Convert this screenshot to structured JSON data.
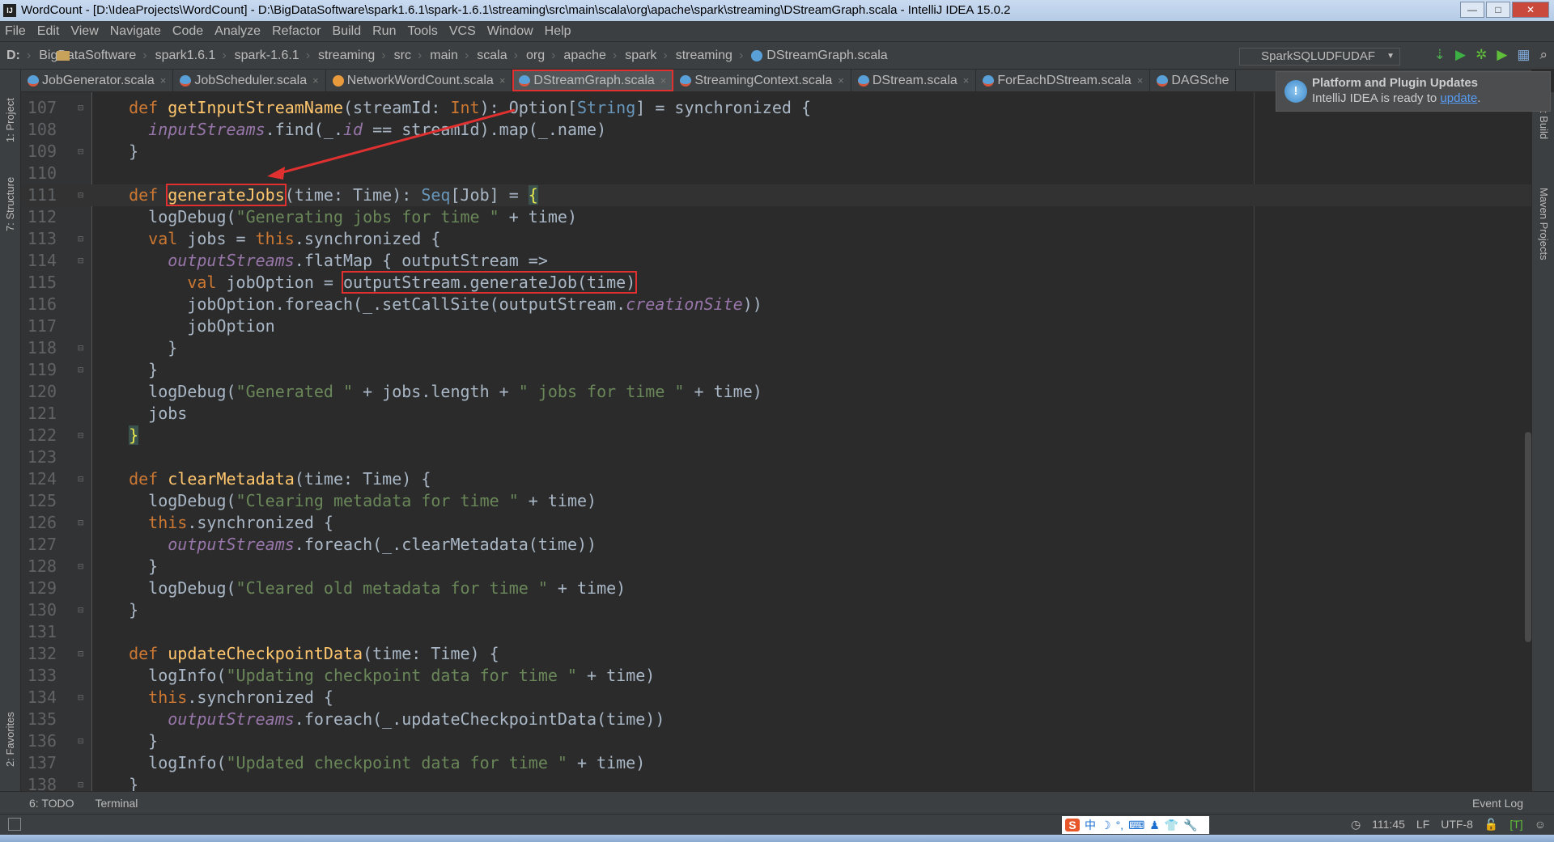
{
  "window": {
    "title": "WordCount - [D:\\IdeaProjects\\WordCount] - D:\\BigDataSoftware\\spark1.6.1\\spark-1.6.1\\streaming\\src\\main\\scala\\org\\apache\\spark\\streaming\\DStreamGraph.scala - IntelliJ IDEA 15.0.2",
    "logo": "IJ",
    "minimize": "—",
    "maximize": "□",
    "close": "✕"
  },
  "menu": [
    "File",
    "Edit",
    "View",
    "Navigate",
    "Code",
    "Analyze",
    "Refactor",
    "Build",
    "Run",
    "Tools",
    "VCS",
    "Window",
    "Help"
  ],
  "breadcrumbs": [
    "D:",
    "BigDataSoftware",
    "spark1.6.1",
    "spark-1.6.1",
    "streaming",
    "src",
    "main",
    "scala",
    "org",
    "apache",
    "spark",
    "streaming",
    "DStreamGraph.scala"
  ],
  "toolbar": {
    "run_config": "SparkSQLUDFUDAF",
    "icons": [
      "binary-icon",
      "run-icon",
      "debug-icon",
      "coverage-icon",
      "project-structure-icon",
      "search-icon"
    ]
  },
  "tabs": [
    {
      "label": "JobGenerator.scala",
      "icon": "class"
    },
    {
      "label": "JobScheduler.scala",
      "icon": "class"
    },
    {
      "label": "NetworkWordCount.scala",
      "icon": "object"
    },
    {
      "label": "DStreamGraph.scala",
      "icon": "class",
      "active": true
    },
    {
      "label": "StreamingContext.scala",
      "icon": "class"
    },
    {
      "label": "DStream.scala",
      "icon": "class"
    },
    {
      "label": "ForEachDStream.scala",
      "icon": "class"
    },
    {
      "label": "DAGSche",
      "icon": "class"
    }
  ],
  "notification": {
    "title": "Platform and Plugin Updates",
    "text": "IntelliJ IDEA is ready to ",
    "link": "update",
    "end": "."
  },
  "left_tools": [
    "1: Project",
    "7: Structure",
    "2: Favorites"
  ],
  "right_tools": [
    "t Build",
    "Maven Projects"
  ],
  "editor": {
    "current_line": 111,
    "lines": [
      {
        "n": 107,
        "fold": true,
        "tokens": [
          [
            "",
            "  "
          ],
          [
            "k",
            "def "
          ],
          [
            "f",
            "getInputStreamName"
          ],
          [
            "",
            "(streamId: "
          ],
          [
            "t",
            "Int"
          ],
          [
            "",
            "): Option["
          ],
          [
            "ty",
            "String"
          ],
          [
            "",
            "] = synchronized {"
          ]
        ]
      },
      {
        "n": 108,
        "tokens": [
          [
            "",
            "    "
          ],
          [
            "i",
            "inputStreams"
          ],
          [
            "",
            ".find(_."
          ],
          [
            "i",
            "id"
          ],
          [
            "",
            " == streamId).map(_.name)"
          ]
        ]
      },
      {
        "n": 109,
        "fold": true,
        "tokens": [
          [
            "",
            "  }"
          ]
        ]
      },
      {
        "n": 110,
        "tokens": []
      },
      {
        "n": 111,
        "fold": true,
        "tokens": [
          [
            "",
            "  "
          ],
          [
            "k",
            "def "
          ],
          [
            "f box",
            "generateJobs"
          ],
          [
            "",
            "(time: Time): "
          ],
          [
            "ty",
            "Seq"
          ],
          [
            "",
            "[Job] = "
          ],
          [
            "br",
            "{"
          ]
        ]
      },
      {
        "n": 112,
        "tokens": [
          [
            "",
            "    logDebug("
          ],
          [
            "s",
            "\"Generating jobs for time \""
          ],
          [
            "",
            " + time)"
          ]
        ]
      },
      {
        "n": 113,
        "fold": true,
        "tokens": [
          [
            "",
            "    "
          ],
          [
            "k",
            "val "
          ],
          [
            "",
            "jobs = "
          ],
          [
            "k",
            "this"
          ],
          [
            "",
            ".synchronized {"
          ]
        ]
      },
      {
        "n": 114,
        "fold": true,
        "tokens": [
          [
            "",
            "      "
          ],
          [
            "i",
            "outputStreams"
          ],
          [
            "",
            ".flatMap { outputStream =>"
          ]
        ]
      },
      {
        "n": 115,
        "tokens": [
          [
            "",
            "        "
          ],
          [
            "k",
            "val "
          ],
          [
            "",
            "jobOption = "
          ],
          [
            "box",
            "outputStream.generateJob(time)"
          ]
        ]
      },
      {
        "n": 116,
        "tokens": [
          [
            "",
            "        jobOption.foreach(_.setCallSite(outputStream."
          ],
          [
            "i",
            "creationSite"
          ],
          [
            "",
            "))"
          ]
        ]
      },
      {
        "n": 117,
        "tokens": [
          [
            "",
            "        jobOption"
          ]
        ]
      },
      {
        "n": 118,
        "fold": true,
        "tokens": [
          [
            "",
            "      }"
          ]
        ]
      },
      {
        "n": 119,
        "fold": true,
        "tokens": [
          [
            "",
            "    }"
          ]
        ]
      },
      {
        "n": 120,
        "tokens": [
          [
            "",
            "    logDebug("
          ],
          [
            "s",
            "\"Generated \""
          ],
          [
            "",
            " + jobs.length + "
          ],
          [
            "s",
            "\" jobs for time \""
          ],
          [
            "",
            " + time)"
          ]
        ]
      },
      {
        "n": 121,
        "tokens": [
          [
            "",
            "    jobs"
          ]
        ]
      },
      {
        "n": 122,
        "fold": true,
        "tokens": [
          [
            "",
            "  "
          ],
          [
            "br",
            "}"
          ]
        ]
      },
      {
        "n": 123,
        "tokens": []
      },
      {
        "n": 124,
        "fold": true,
        "tokens": [
          [
            "",
            "  "
          ],
          [
            "k",
            "def "
          ],
          [
            "f",
            "clearMetadata"
          ],
          [
            "",
            "(time: Time) {"
          ]
        ]
      },
      {
        "n": 125,
        "tokens": [
          [
            "",
            "    logDebug("
          ],
          [
            "s",
            "\"Clearing metadata for time \""
          ],
          [
            "",
            " + time)"
          ]
        ]
      },
      {
        "n": 126,
        "fold": true,
        "tokens": [
          [
            "",
            "    "
          ],
          [
            "k",
            "this"
          ],
          [
            "",
            ".synchronized {"
          ]
        ]
      },
      {
        "n": 127,
        "tokens": [
          [
            "",
            "      "
          ],
          [
            "i",
            "outputStreams"
          ],
          [
            "",
            ".foreach(_.clearMetadata(time))"
          ]
        ]
      },
      {
        "n": 128,
        "fold": true,
        "tokens": [
          [
            "",
            "    }"
          ]
        ]
      },
      {
        "n": 129,
        "tokens": [
          [
            "",
            "    logDebug("
          ],
          [
            "s",
            "\"Cleared old metadata for time \""
          ],
          [
            "",
            " + time)"
          ]
        ]
      },
      {
        "n": 130,
        "fold": true,
        "tokens": [
          [
            "",
            "  }"
          ]
        ]
      },
      {
        "n": 131,
        "tokens": []
      },
      {
        "n": 132,
        "fold": true,
        "tokens": [
          [
            "",
            "  "
          ],
          [
            "k",
            "def "
          ],
          [
            "f",
            "updateCheckpointData"
          ],
          [
            "",
            "(time: Time) {"
          ]
        ]
      },
      {
        "n": 133,
        "tokens": [
          [
            "",
            "    logInfo("
          ],
          [
            "s",
            "\"Updating checkpoint data for time \""
          ],
          [
            "",
            " + time)"
          ]
        ]
      },
      {
        "n": 134,
        "fold": true,
        "tokens": [
          [
            "",
            "    "
          ],
          [
            "k",
            "this"
          ],
          [
            "",
            ".synchronized {"
          ]
        ]
      },
      {
        "n": 135,
        "tokens": [
          [
            "",
            "      "
          ],
          [
            "i",
            "outputStreams"
          ],
          [
            "",
            ".foreach(_.updateCheckpointData(time))"
          ]
        ]
      },
      {
        "n": 136,
        "fold": true,
        "tokens": [
          [
            "",
            "    }"
          ]
        ]
      },
      {
        "n": 137,
        "tokens": [
          [
            "",
            "    logInfo("
          ],
          [
            "s",
            "\"Updated checkpoint data for time \""
          ],
          [
            "",
            " + time)"
          ]
        ]
      },
      {
        "n": 138,
        "fold": true,
        "tokens": [
          [
            "",
            "  }"
          ]
        ]
      }
    ]
  },
  "bottom_tools": {
    "todo": "6: TODO",
    "terminal": "Terminal",
    "event_log": "Event Log"
  },
  "status": {
    "position": "111:45",
    "line_sep": "LF",
    "encoding": "UTF-8",
    "ime": [
      "中",
      "☽",
      "°,",
      "⌨",
      "♟",
      "👕",
      "🔧"
    ],
    "ime_logo": "S"
  },
  "colors": {
    "highlight": "#e03030",
    "keyword": "#cc7832",
    "string": "#6a8759",
    "function": "#ffc66d",
    "field": "#9876aa"
  }
}
